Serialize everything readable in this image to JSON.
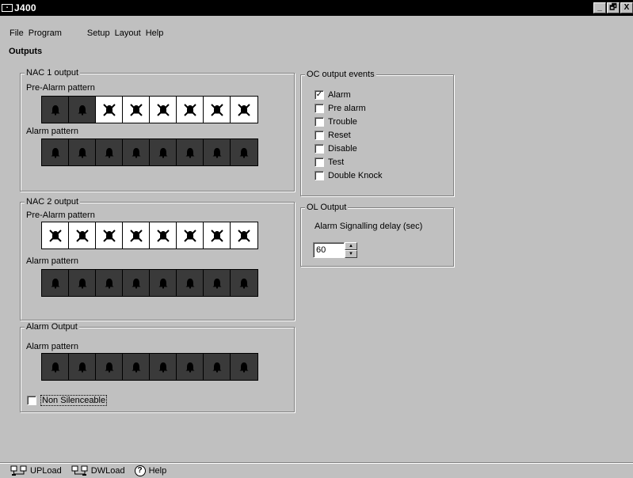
{
  "window": {
    "title": "J400",
    "controls": [
      "_",
      "🗗",
      "X"
    ]
  },
  "menu": {
    "items": [
      "File",
      "Program",
      "Setup",
      "Layout",
      "Help"
    ]
  },
  "page": {
    "title": "Outputs"
  },
  "nac1": {
    "title": "NAC 1 output",
    "pre_alarm_label": "Pre-Alarm pattern",
    "pre_alarm_pattern": [
      true,
      true,
      false,
      false,
      false,
      false,
      false,
      false
    ],
    "alarm_label": "Alarm pattern",
    "alarm_pattern": [
      true,
      true,
      true,
      true,
      true,
      true,
      true,
      true
    ]
  },
  "nac2": {
    "title": "NAC 2 output",
    "pre_alarm_label": "Pre-Alarm pattern",
    "pre_alarm_pattern": [
      false,
      false,
      false,
      false,
      false,
      false,
      false,
      false
    ],
    "alarm_label": "Alarm pattern",
    "alarm_pattern": [
      true,
      true,
      true,
      true,
      true,
      true,
      true,
      true
    ]
  },
  "alarm_output": {
    "title": "Alarm Output",
    "alarm_label": "Alarm pattern",
    "alarm_pattern": [
      true,
      true,
      true,
      true,
      true,
      true,
      true,
      true
    ],
    "non_silenceable_label": "Non Silenceable",
    "non_silenceable_checked": false
  },
  "oc_events": {
    "title": "OC output events",
    "items": [
      {
        "label": "Alarm",
        "checked": true
      },
      {
        "label": "Pre alarm",
        "checked": false
      },
      {
        "label": "Trouble",
        "checked": false
      },
      {
        "label": "Reset",
        "checked": false
      },
      {
        "label": "Disable",
        "checked": false
      },
      {
        "label": "Test",
        "checked": false
      },
      {
        "label": "Double Knock",
        "checked": false
      }
    ]
  },
  "ol_output": {
    "title": "OL Output",
    "delay_label": "Alarm Signalling delay (sec)",
    "delay_value": "60"
  },
  "statusbar": {
    "upload": "UPLoad",
    "download": "DWLoad",
    "help": "Help",
    "help_glyph": "?"
  },
  "colors": {
    "pattern_on": "#3a3a3a",
    "pattern_off": "#ffffff",
    "face": "#c0c0c0"
  }
}
